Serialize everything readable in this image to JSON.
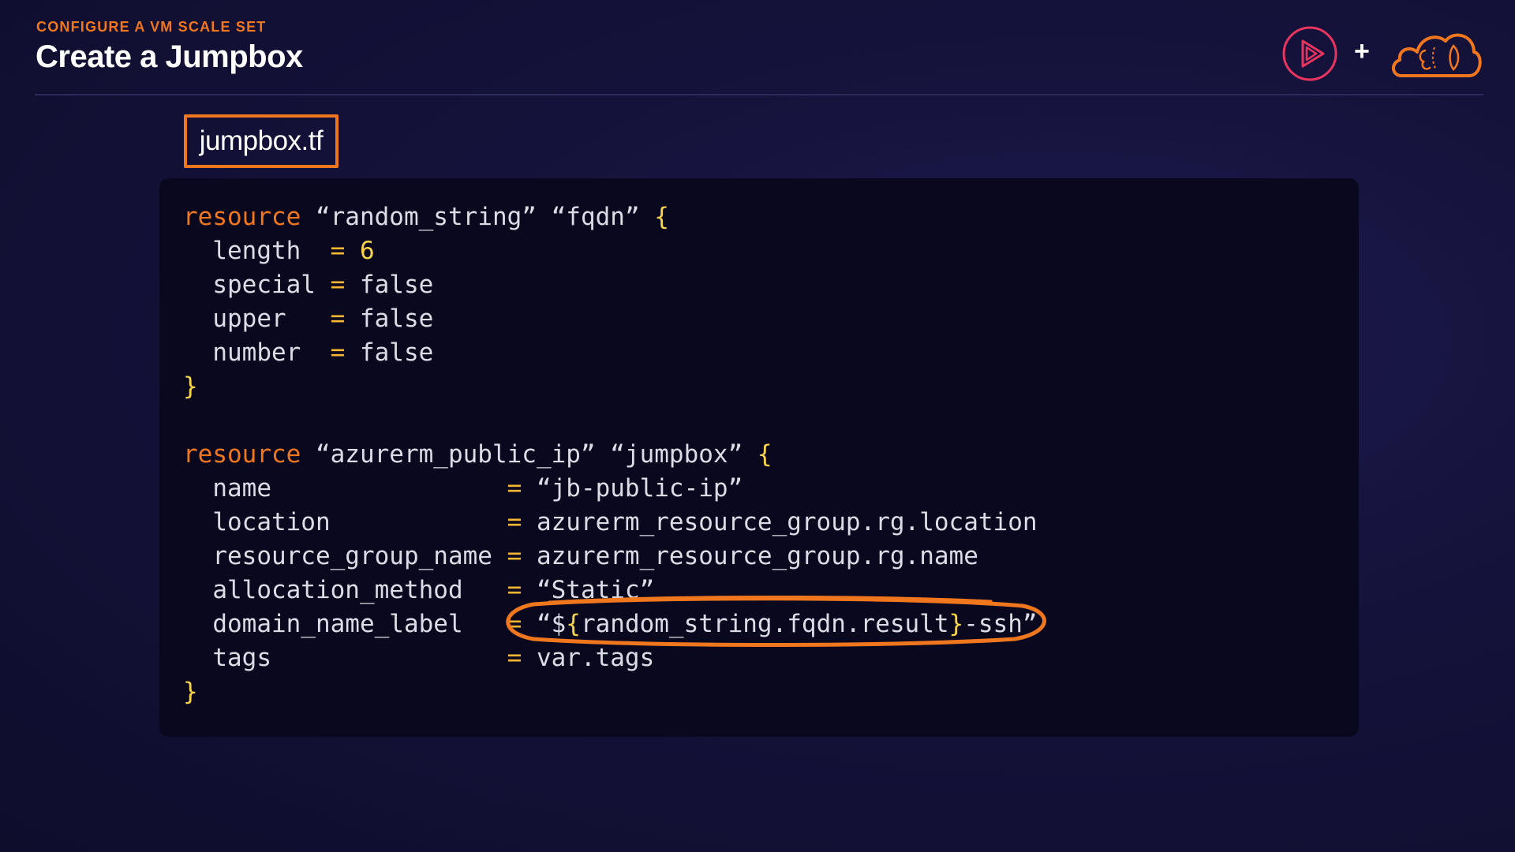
{
  "header": {
    "eyebrow": "CONFIGURE A VM SCALE SET",
    "title": "Create a Jumpbox"
  },
  "logos": {
    "play_icon": "pluralsight-play-icon",
    "plus": "+",
    "cloud_icon": "brain-cloud-icon"
  },
  "file_tag": "jumpbox.tf",
  "colors": {
    "accent": "#f0771e",
    "operator": "#f7b733",
    "number": "#f9d44a",
    "background": "#14123a",
    "code_bg": "#09081f",
    "text": "#dcdce6"
  },
  "code": {
    "block1": {
      "keyword": "resource",
      "type": "“random_string”",
      "name": "“fqdn”",
      "open": "{",
      "close": "}",
      "attrs": [
        {
          "key": "length",
          "pad": "  ",
          "eq": "=",
          "value": "6"
        },
        {
          "key": "special",
          "pad": " ",
          "eq": "=",
          "value": "false"
        },
        {
          "key": "upper",
          "pad": "   ",
          "eq": "=",
          "value": "false"
        },
        {
          "key": "number",
          "pad": "  ",
          "eq": "=",
          "value": "false"
        }
      ]
    },
    "block2": {
      "keyword": "resource",
      "type": "“azurerm_public_ip”",
      "name": "“jumpbox”",
      "open": "{",
      "close": "}",
      "attrs": [
        {
          "key": "name",
          "pad": "                ",
          "eq": "=",
          "value": "“jb-public-ip”"
        },
        {
          "key": "location",
          "pad": "            ",
          "eq": "=",
          "value": "azurerm_resource_group.rg.location"
        },
        {
          "key": "resource_group_name",
          "pad": " ",
          "eq": "=",
          "value": "azurerm_resource_group.rg.name"
        },
        {
          "key": "allocation_method",
          "pad": "   ",
          "eq": "=",
          "value": "“Static”"
        },
        {
          "key": "domain_name_label",
          "pad": "   ",
          "eq": "=",
          "value_prefix": "“$",
          "value_open": "{",
          "value_mid": "random_string.fqdn.result",
          "value_close": "}",
          "value_suffix": "-ssh”"
        },
        {
          "key": "tags",
          "pad": "                ",
          "eq": "=",
          "value": "var.tags"
        }
      ]
    }
  }
}
